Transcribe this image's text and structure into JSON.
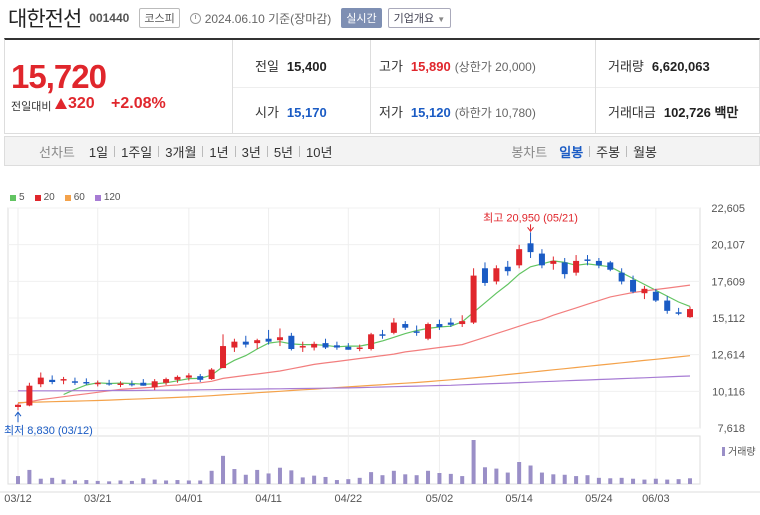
{
  "header": {
    "name": "대한전선",
    "code": "001440",
    "market": "코스피",
    "date": "2024.06.10 기준(장마감)",
    "live_label": "실시간",
    "company_label": "기업개요"
  },
  "summary": {
    "price": "15,720",
    "change_label": "전일대비",
    "change_value": "320",
    "change_pct": "+2.08%",
    "prev_close_label": "전일",
    "prev_close": "15,400",
    "high_label": "고가",
    "high": "15,890",
    "upper_limit": "(상한가 20,000)",
    "volume_label": "거래량",
    "volume": "6,620,063",
    "open_label": "시가",
    "open": "15,170",
    "low_label": "저가",
    "low": "15,120",
    "lower_limit": "(하한가 10,780)",
    "amount_label": "거래대금",
    "amount": "102,726 백만"
  },
  "tabs": {
    "line_head": "선차트",
    "line_items": [
      "1일",
      "1주일",
      "3개월",
      "1년",
      "3년",
      "5년",
      "10년"
    ],
    "candle_head": "봉차트",
    "candle_items": [
      "일봉",
      "주봉",
      "월봉"
    ],
    "active_candle": "일봉"
  },
  "colors": {
    "up": "#e0262c",
    "down": "#1a5bc4",
    "ma5": "#62c462",
    "ma20": "#f27e7e",
    "ma60": "#f4a24a",
    "ma120": "#a77cd4"
  },
  "chart_data": {
    "type": "candlestick",
    "legend": [
      "5",
      "20",
      "60",
      "120"
    ],
    "y_ticks": [
      "22,605",
      "20,107",
      "17,609",
      "15,112",
      "12,614",
      "10,116",
      "7,618"
    ],
    "ylim": [
      7618,
      22605
    ],
    "x_ticks": [
      "03/12",
      "03/21",
      "04/01",
      "04/11",
      "04/22",
      "05/02",
      "05/14",
      "05/24",
      "06/03"
    ],
    "max_label": "최고 20,950 (05/21)",
    "min_label": "최저 8,830 (03/12)",
    "volume_label": "거래량",
    "candles": [
      {
        "o": 9050,
        "h": 9280,
        "l": 8830,
        "c": 9200
      },
      {
        "o": 9150,
        "h": 10700,
        "l": 9100,
        "c": 10500
      },
      {
        "o": 10600,
        "h": 11400,
        "l": 10400,
        "c": 11050
      },
      {
        "o": 10900,
        "h": 11200,
        "l": 10600,
        "c": 10750
      },
      {
        "o": 10850,
        "h": 11100,
        "l": 10600,
        "c": 10950
      },
      {
        "o": 10800,
        "h": 11050,
        "l": 10550,
        "c": 10700
      },
      {
        "o": 10750,
        "h": 11000,
        "l": 10550,
        "c": 10650
      },
      {
        "o": 10600,
        "h": 10850,
        "l": 10450,
        "c": 10700
      },
      {
        "o": 10650,
        "h": 10900,
        "l": 10500,
        "c": 10600
      },
      {
        "o": 10550,
        "h": 10800,
        "l": 10400,
        "c": 10650
      },
      {
        "o": 10600,
        "h": 10850,
        "l": 10450,
        "c": 10550
      },
      {
        "o": 10700,
        "h": 10950,
        "l": 10500,
        "c": 10500
      },
      {
        "o": 10400,
        "h": 10950,
        "l": 10200,
        "c": 10800
      },
      {
        "o": 10700,
        "h": 11050,
        "l": 10550,
        "c": 10950
      },
      {
        "o": 10900,
        "h": 11200,
        "l": 10700,
        "c": 11100
      },
      {
        "o": 11050,
        "h": 11350,
        "l": 10850,
        "c": 11200
      },
      {
        "o": 11150,
        "h": 11300,
        "l": 10750,
        "c": 10900
      },
      {
        "o": 10950,
        "h": 11700,
        "l": 10900,
        "c": 11600
      },
      {
        "o": 11700,
        "h": 14000,
        "l": 11700,
        "c": 13200
      },
      {
        "o": 13100,
        "h": 13700,
        "l": 12800,
        "c": 13500
      },
      {
        "o": 13500,
        "h": 13900,
        "l": 13100,
        "c": 13300
      },
      {
        "o": 13400,
        "h": 13700,
        "l": 13000,
        "c": 13600
      },
      {
        "o": 13700,
        "h": 14300,
        "l": 13300,
        "c": 13500
      },
      {
        "o": 13600,
        "h": 14400,
        "l": 13200,
        "c": 13800
      },
      {
        "o": 13900,
        "h": 14100,
        "l": 12900,
        "c": 13000
      },
      {
        "o": 13100,
        "h": 13500,
        "l": 12800,
        "c": 13200
      },
      {
        "o": 13100,
        "h": 13500,
        "l": 12900,
        "c": 13350
      },
      {
        "o": 13400,
        "h": 13700,
        "l": 13000,
        "c": 13100
      },
      {
        "o": 13250,
        "h": 13500,
        "l": 12950,
        "c": 13100
      },
      {
        "o": 13150,
        "h": 13400,
        "l": 12950,
        "c": 12950
      },
      {
        "o": 13000,
        "h": 13300,
        "l": 12850,
        "c": 13100
      },
      {
        "o": 13000,
        "h": 14100,
        "l": 12900,
        "c": 14000
      },
      {
        "o": 14000,
        "h": 14300,
        "l": 13700,
        "c": 13900
      },
      {
        "o": 14100,
        "h": 15100,
        "l": 14000,
        "c": 14800
      },
      {
        "o": 14700,
        "h": 14900,
        "l": 14300,
        "c": 14450
      },
      {
        "o": 14200,
        "h": 14600,
        "l": 13900,
        "c": 14100
      },
      {
        "o": 13700,
        "h": 14800,
        "l": 13600,
        "c": 14700
      },
      {
        "o": 14700,
        "h": 15000,
        "l": 14300,
        "c": 14500
      },
      {
        "o": 14800,
        "h": 15100,
        "l": 14500,
        "c": 14650
      },
      {
        "o": 14700,
        "h": 15300,
        "l": 14500,
        "c": 14900
      },
      {
        "o": 14800,
        "h": 18500,
        "l": 14700,
        "c": 18000
      },
      {
        "o": 18500,
        "h": 18900,
        "l": 17300,
        "c": 17500
      },
      {
        "o": 17600,
        "h": 18700,
        "l": 17400,
        "c": 18500
      },
      {
        "o": 18600,
        "h": 19000,
        "l": 18000,
        "c": 18300
      },
      {
        "o": 18700,
        "h": 20100,
        "l": 18500,
        "c": 19800
      },
      {
        "o": 20200,
        "h": 20950,
        "l": 19200,
        "c": 19600
      },
      {
        "o": 19500,
        "h": 19800,
        "l": 18500,
        "c": 18700
      },
      {
        "o": 18800,
        "h": 19300,
        "l": 18400,
        "c": 19000
      },
      {
        "o": 18900,
        "h": 19200,
        "l": 17800,
        "c": 18100
      },
      {
        "o": 18200,
        "h": 19400,
        "l": 18000,
        "c": 19000
      },
      {
        "o": 19100,
        "h": 19400,
        "l": 18700,
        "c": 19000
      },
      {
        "o": 19000,
        "h": 19200,
        "l": 18500,
        "c": 18700
      },
      {
        "o": 18900,
        "h": 19000,
        "l": 18300,
        "c": 18400
      },
      {
        "o": 18200,
        "h": 18500,
        "l": 17400,
        "c": 17600
      },
      {
        "o": 17700,
        "h": 18000,
        "l": 16800,
        "c": 16900
      },
      {
        "o": 16800,
        "h": 17300,
        "l": 16400,
        "c": 17100
      },
      {
        "o": 16900,
        "h": 17100,
        "l": 16200,
        "c": 16300
      },
      {
        "o": 16300,
        "h": 16600,
        "l": 15400,
        "c": 15600
      },
      {
        "o": 15500,
        "h": 15800,
        "l": 15300,
        "c": 15400
      },
      {
        "o": 15170,
        "h": 15890,
        "l": 15120,
        "c": 15720
      }
    ],
    "volumes": [
      0.18,
      0.32,
      0.12,
      0.14,
      0.1,
      0.08,
      0.09,
      0.07,
      0.06,
      0.08,
      0.07,
      0.13,
      0.1,
      0.08,
      0.09,
      0.08,
      0.08,
      0.3,
      0.64,
      0.34,
      0.21,
      0.32,
      0.24,
      0.37,
      0.31,
      0.15,
      0.19,
      0.16,
      0.09,
      0.11,
      0.14,
      0.27,
      0.2,
      0.3,
      0.22,
      0.2,
      0.3,
      0.25,
      0.23,
      0.18,
      1.0,
      0.38,
      0.35,
      0.26,
      0.5,
      0.42,
      0.26,
      0.22,
      0.21,
      0.18,
      0.2,
      0.14,
      0.13,
      0.14,
      0.12,
      0.1,
      0.12,
      0.1,
      0.11,
      0.13
    ],
    "ma": {
      "ma5": [
        null,
        null,
        null,
        null,
        9900,
        10250,
        10550,
        10700,
        10650,
        10680,
        10650,
        10600,
        10620,
        10700,
        10830,
        10980,
        11000,
        11220,
        11800,
        12230,
        12550,
        13000,
        13400,
        13500,
        13350,
        13300,
        13300,
        13250,
        13150,
        13200,
        13200,
        13350,
        13550,
        13800,
        14050,
        14250,
        14400,
        14500,
        14550,
        14850,
        15500,
        16150,
        16800,
        17400,
        18100,
        18600,
        18800,
        19000,
        18900,
        18700,
        18800,
        18700,
        18600,
        18200,
        17800,
        17400,
        17000,
        16600,
        16200,
        15900
      ],
      "ma20": [
        9300,
        9400,
        9550,
        9650,
        9750,
        9850,
        9950,
        10050,
        10150,
        10250,
        10300,
        10350,
        10400,
        10500,
        10550,
        10650,
        10700,
        10800,
        11000,
        11100,
        11200,
        11300,
        11400,
        11500,
        11650,
        11800,
        11950,
        12050,
        12150,
        12250,
        12350,
        12450,
        12550,
        12650,
        12800,
        12900,
        13000,
        13100,
        13200,
        13300,
        13550,
        13800,
        14050,
        14300,
        14550,
        14800,
        15000,
        15300,
        15550,
        15800,
        16050,
        16300,
        16550,
        16700,
        16850,
        16950,
        17050,
        17150,
        17250,
        17350
      ],
      "ma60": [
        9350,
        9370,
        9390,
        9410,
        9430,
        9450,
        9470,
        9490,
        9520,
        9550,
        9580,
        9610,
        9640,
        9670,
        9700,
        9740,
        9780,
        9820,
        9870,
        9920,
        9970,
        10020,
        10070,
        10120,
        10170,
        10220,
        10270,
        10320,
        10370,
        10420,
        10470,
        10520,
        10570,
        10620,
        10670,
        10720,
        10780,
        10840,
        10900,
        10960,
        11030,
        11100,
        11180,
        11260,
        11340,
        11420,
        11500,
        11580,
        11660,
        11740,
        11820,
        11900,
        11980,
        12060,
        12140,
        12220,
        12300,
        12380,
        12460,
        12540
      ],
      "ma120": [
        10150,
        10150,
        10150,
        10150,
        10150,
        10160,
        10160,
        10160,
        10170,
        10170,
        10170,
        10180,
        10190,
        10190,
        10200,
        10210,
        10220,
        10230,
        10240,
        10250,
        10260,
        10270,
        10280,
        10290,
        10300,
        10310,
        10320,
        10330,
        10340,
        10350,
        10370,
        10390,
        10410,
        10430,
        10450,
        10470,
        10490,
        10510,
        10530,
        10560,
        10590,
        10620,
        10650,
        10680,
        10710,
        10740,
        10770,
        10800,
        10830,
        10860,
        10890,
        10920,
        10950,
        10980,
        11010,
        11040,
        11070,
        11100,
        11130,
        11160
      ]
    }
  }
}
